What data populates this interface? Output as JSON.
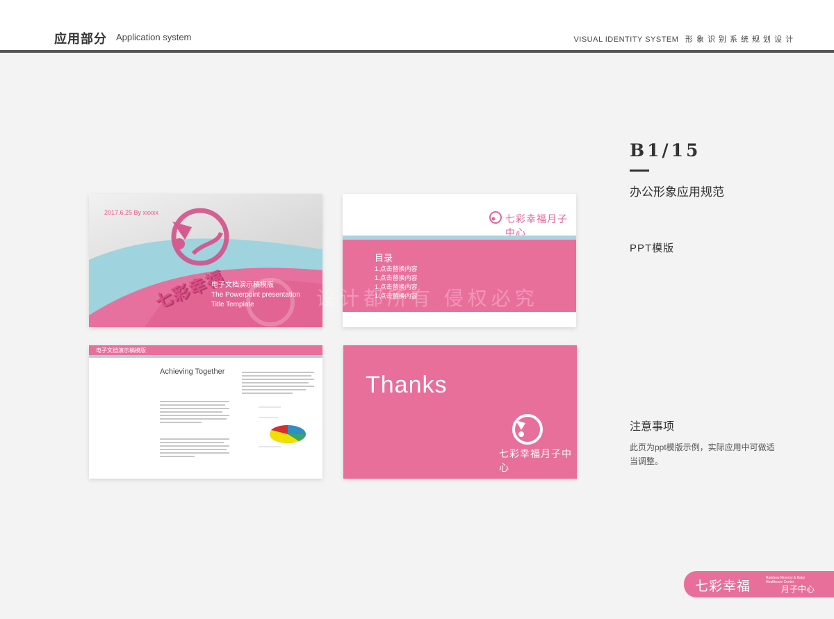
{
  "header": {
    "title": "应用部分",
    "subtitle": "Application system",
    "right_en": "VISUAL IDENTITY SYSTEM",
    "right_cn": "形象识别系统规划设计"
  },
  "panel": {
    "page_code": "B1/15",
    "section": "办公形象应用规范",
    "item": "PPT模版",
    "note_title": "注意事项",
    "note_body": "此页为ppt模版示例，实际应用中可做适当调整。"
  },
  "slide1": {
    "date": "2017.6.25 By xxxxx",
    "title_cn": "电子文档演示稿模版",
    "title_en_1": "The Powerpoint presentation",
    "title_en_2": "Title Template",
    "brand": "七彩幸福"
  },
  "slide2": {
    "heading": "目录",
    "items": [
      "1.点击替换内容",
      "1.点击替换内容",
      "1.点击替换内容",
      "1.点击替换内容"
    ],
    "brand": "七彩幸福月子中心"
  },
  "slide3": {
    "bar_title": "电子文档演示稿模版",
    "title": "Achieving Together"
  },
  "slide4": {
    "thanks": "Thanks",
    "brand": "七彩幸福月子中心"
  },
  "watermark": "设计都所有 侵权必究",
  "footer": {
    "brand": "七彩幸福",
    "small": "Rainbow Mommy & Baby Healthcare Center",
    "sub": "月子中心"
  },
  "colors": {
    "brand_pink": "#e86f9a",
    "light_blue": "#a9d3de",
    "dark": "#333333"
  },
  "icons": [
    "brand-logo-icon",
    "watermark-icon"
  ]
}
